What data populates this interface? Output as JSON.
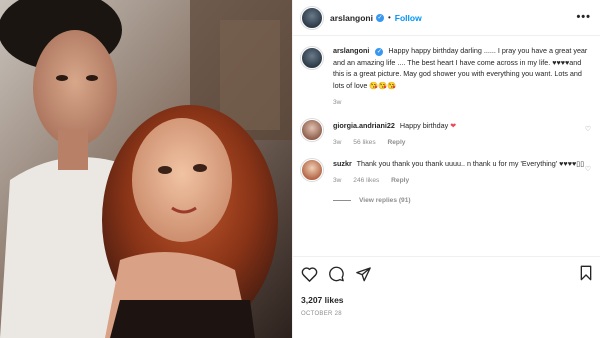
{
  "post": {
    "username": "arslangoni",
    "follow_label": "Follow",
    "more_label": "•••",
    "dot": "•"
  },
  "caption": {
    "username": "arslangoni",
    "text": "Happy happy birthday darling ...... I pray you have a great year and an amazing life .... The best heart I have come across in my life. ♥♥♥♥and this is a great picture. May god shower you with everything you want. Lots and lots of love",
    "emojis": "😘😘😘",
    "time": "3w"
  },
  "comments": [
    {
      "username": "giorgia.andriani22",
      "text": "Happy birthday",
      "heart": "❤",
      "time": "3w",
      "likes": "56 likes",
      "reply": "Reply"
    },
    {
      "username": "suzkr",
      "text": "Thank you thank you thank uuuu.. n thank u for my 'Everything' ♥♥♥♥▯▯",
      "time": "3w",
      "likes": "246 likes",
      "reply": "Reply"
    }
  ],
  "view_replies": "View replies (91)",
  "likes_count": "3,207 likes",
  "date": "OCTOBER 28",
  "icons": {
    "like": "heart-outline-icon",
    "comment": "comment-icon",
    "share": "share-icon",
    "save": "bookmark-icon",
    "comment_like": "small-heart-icon"
  },
  "colors": {
    "link": "#0095f6",
    "verified": "#3897f0",
    "muted": "#8e8e8e",
    "text": "#262626",
    "heart": "#ed4956"
  }
}
